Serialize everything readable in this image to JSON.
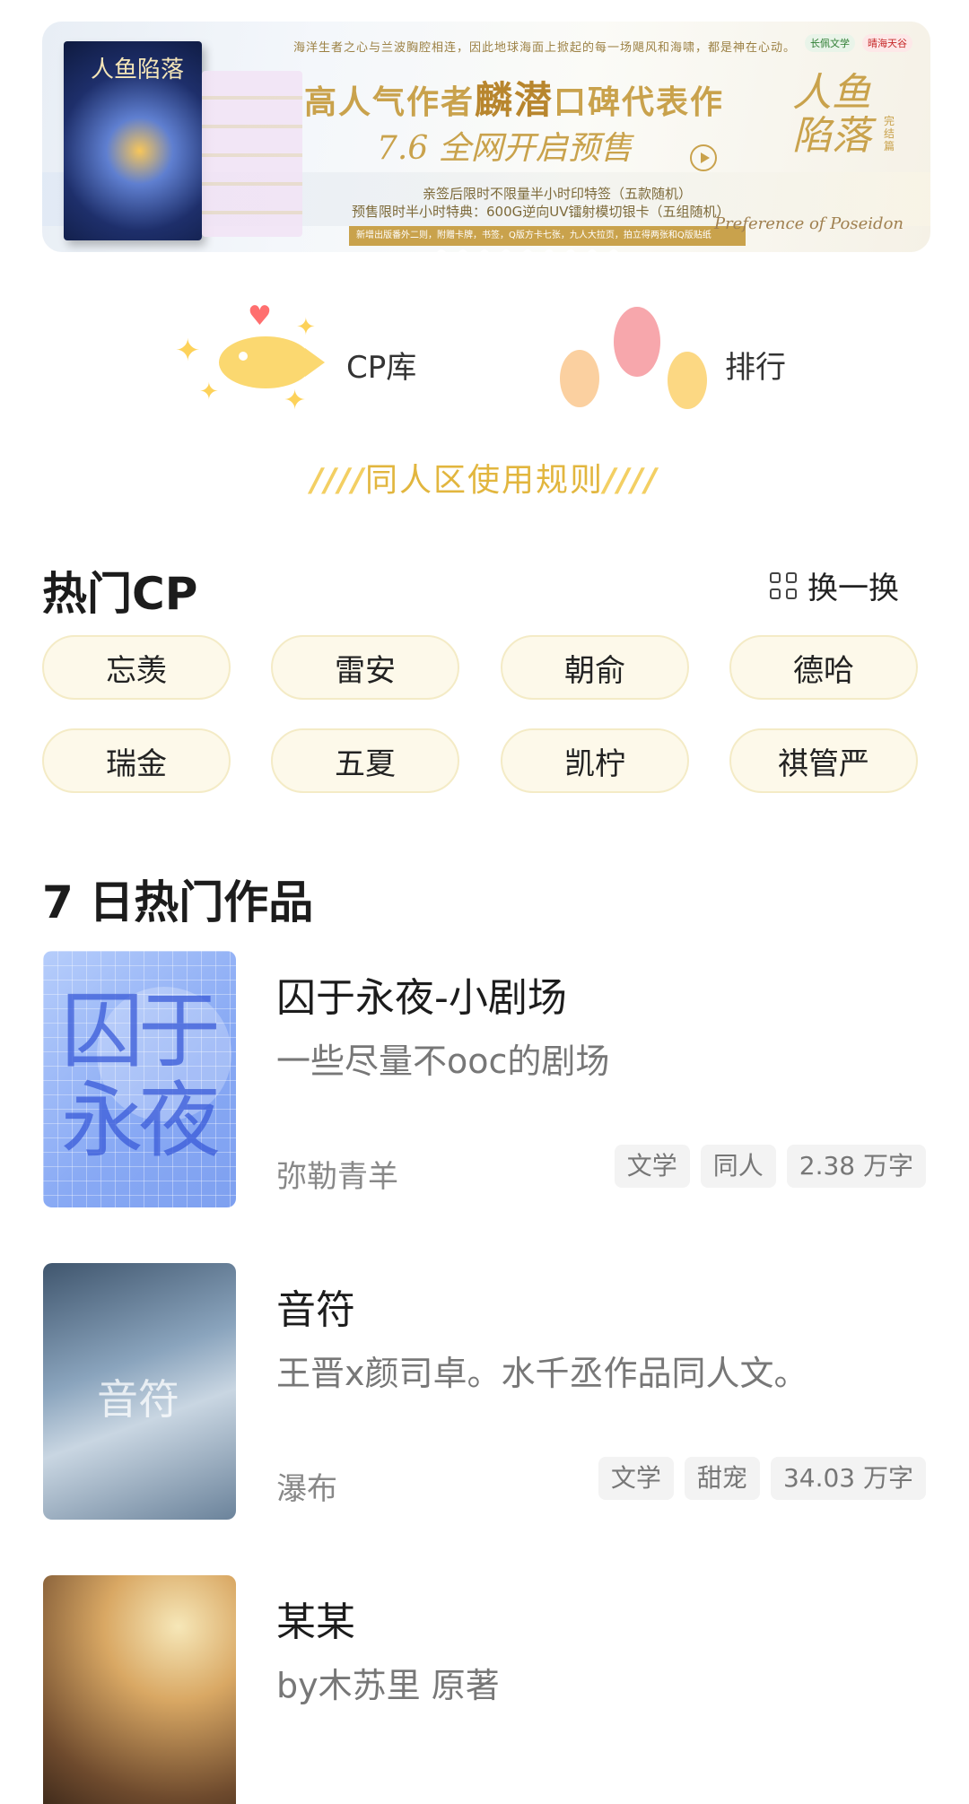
{
  "banner": {
    "top_line": "海洋生者之心与兰波胸腔相连，因此地球海面上掀起的每一场飓风和海啸，都是神在心动。",
    "headline_prefix": "高人气作者",
    "headline_author": "麟潜",
    "headline_suffix": "口碑代表作",
    "presale": "7.6 全网开启预售",
    "line1": "亲签后限时不限量半小时印特签（五款随机）",
    "line2": "预售限时半小时特典：600G逆向UV镭射模切银卡（五组随机）",
    "strip": "新增出版番外二则，附赠卡牌，书签，Q版方卡七张，九人大拉页，拍立得两张和Q版贴纸",
    "book_title": "人鱼陷落",
    "vertical_title": "人鱼陷落",
    "vertical_sub": "完结篇",
    "english": "Preference of Poseidon",
    "logo1": "长佩文学",
    "logo2": "晴海天谷"
  },
  "entries": {
    "cp_label": "CP库",
    "rank_label": "排行"
  },
  "rules": {
    "slash_left": "////",
    "text": "同人区使用规则",
    "slash_right": "////"
  },
  "hot_cp": {
    "title": "热门CP",
    "switch_label": "换一换",
    "chips": [
      "忘羡",
      "雷安",
      "朝俞",
      "德哈",
      "瑞金",
      "五夏",
      "凯柠",
      "祺管严"
    ]
  },
  "hot_works": {
    "title": "7 日热门作品",
    "items": [
      {
        "title": "囚于永夜-小剧场",
        "desc": "一些尽量不ooc的剧场",
        "author": "弥勒青羊",
        "tags": [
          "文学",
          "同人",
          "2.38 万字"
        ],
        "cover_text": "囚于永夜"
      },
      {
        "title": "音符",
        "desc": "王晋x颜司卓。水千丞作品同人文。",
        "author": "瀑布",
        "tags": [
          "文学",
          "甜宠",
          "34.03 万字"
        ],
        "cover_text": "音符"
      },
      {
        "title": "某某",
        "desc": "by木苏里   原著",
        "author": "",
        "tags": [],
        "cover_text": ""
      }
    ]
  },
  "colors": {
    "accent": "#e2b63e",
    "chip_bg": "#fdf9ea",
    "tag_bg": "#f3f3f3"
  }
}
